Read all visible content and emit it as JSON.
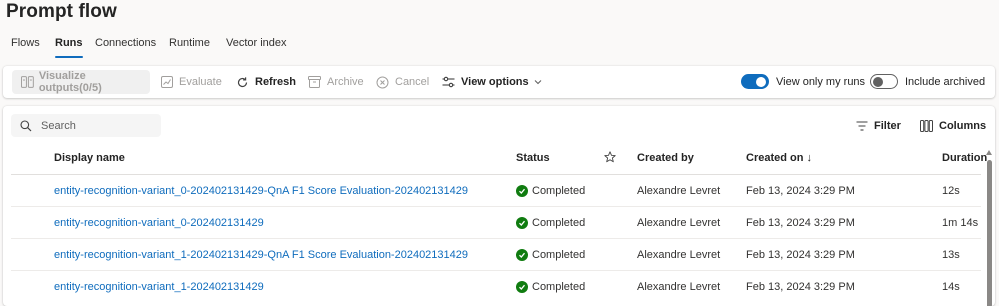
{
  "app": {
    "title": "Prompt flow"
  },
  "tabs": [
    {
      "label": "Flows",
      "active": false
    },
    {
      "label": "Runs",
      "active": true
    },
    {
      "label": "Connections",
      "active": false
    },
    {
      "label": "Runtime",
      "active": false
    },
    {
      "label": "Vector index",
      "active": false
    }
  ],
  "toolbar": {
    "visualize_label": "Visualize outputs(0/5)",
    "evaluate_label": "Evaluate",
    "refresh_label": "Refresh",
    "archive_label": "Archive",
    "cancel_label": "Cancel",
    "view_options_label": "View options",
    "view_only_my_runs": {
      "label": "View only my runs",
      "on": true
    },
    "include_archived": {
      "label": "Include archived",
      "on": false
    }
  },
  "search": {
    "placeholder": "Search"
  },
  "table_actions": {
    "filter_label": "Filter",
    "columns_label": "Columns"
  },
  "table": {
    "columns": {
      "display_name": "Display name",
      "status": "Status",
      "created_by": "Created by",
      "created_on": "Created on ↓",
      "duration": "Duration"
    },
    "rows": [
      {
        "display_name": "entity-recognition-variant_0-202402131429-QnA F1 Score Evaluation-202402131429",
        "status": "Completed",
        "created_by": "Alexandre Levret",
        "created_on": "Feb 13, 2024 3:29 PM",
        "duration": "12s"
      },
      {
        "display_name": "entity-recognition-variant_0-202402131429",
        "status": "Completed",
        "created_by": "Alexandre Levret",
        "created_on": "Feb 13, 2024 3:29 PM",
        "duration": "1m 14s"
      },
      {
        "display_name": "entity-recognition-variant_1-202402131429-QnA F1 Score Evaluation-202402131429",
        "status": "Completed",
        "created_by": "Alexandre Levret",
        "created_on": "Feb 13, 2024 3:29 PM",
        "duration": "13s"
      },
      {
        "display_name": "entity-recognition-variant_1-202402131429",
        "status": "Completed",
        "created_by": "Alexandre Levret",
        "created_on": "Feb 13, 2024 3:29 PM",
        "duration": "14s"
      }
    ]
  },
  "colors": {
    "accent": "#0f6cbd",
    "success": "#107c10",
    "link": "#0f6cbd"
  },
  "icons": {
    "visualize": "compare-icon",
    "evaluate": "chart-icon",
    "refresh": "refresh-icon",
    "archive": "archive-icon",
    "cancel": "dismiss-circle-icon",
    "view_options": "options-icon",
    "search": "search-icon",
    "filter": "filter-icon",
    "columns": "columns-icon",
    "favorite": "star-icon",
    "status": "checkmark-circle-icon"
  }
}
